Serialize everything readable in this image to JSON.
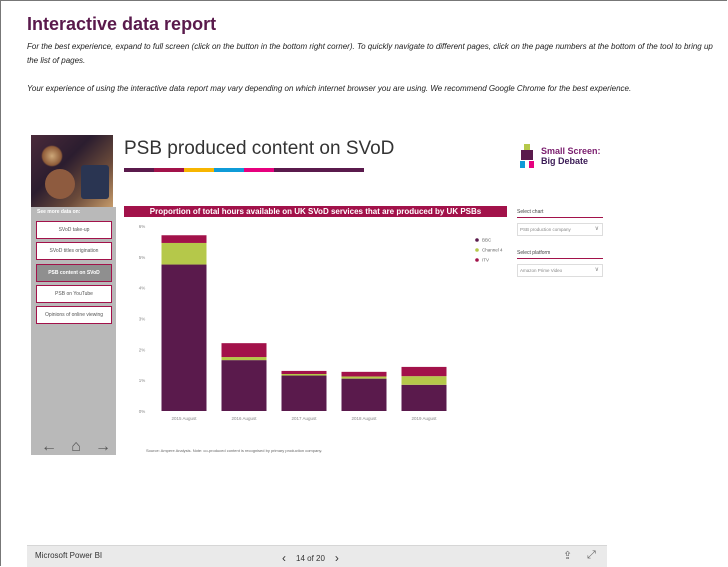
{
  "page": {
    "title": "Interactive data report",
    "intro1": "For the best experience, expand to full screen (click on the button in the bottom right corner). To quickly navigate to different pages, click on the page numbers at the bottom of the tool to bring up the list of pages.",
    "intro2": "Your experience of using the interactive data report may vary depending on which internet browser you are using. We recommend Google Chrome for the best experience."
  },
  "report": {
    "title": "PSB produced content on SVoD",
    "brand_line1": "Small Screen:",
    "brand_line2": "Big Debate",
    "color_bar": [
      "#5a1a4c",
      "#a2124a",
      "#f7b500",
      "#0f9bd7",
      "#e6007e",
      "#5a1a4c",
      "#5a1a4c",
      "#5a1a4c"
    ],
    "nav": {
      "header": "See more data on:",
      "items": [
        {
          "label": "SVoD take-up",
          "active": false
        },
        {
          "label": "SVoD titles origination",
          "active": false
        },
        {
          "label": "PSB content on SVoD",
          "active": true
        },
        {
          "label": "PSB on YouTube",
          "active": false
        },
        {
          "label": "Opinions of online viewing",
          "active": false
        }
      ]
    },
    "controls": {
      "chart_label": "Select chart",
      "chart_value": "PSB production company",
      "platform_label": "Select platform",
      "platform_value": "Amazon Prime Video"
    },
    "source": "Source: Ampere Analysis. Note: co-produced content is recognised by primary production company."
  },
  "chart_data": {
    "type": "bar",
    "stacked": true,
    "title": "Proportion of total hours available on UK SVoD services that are produced by UK PSBs",
    "categories": [
      "2015 August",
      "2016 August",
      "2017 August",
      "2018 August",
      "2019 August"
    ],
    "series": [
      {
        "name": "BBC",
        "color": "#5a1a4c",
        "values": [
          4.75,
          1.65,
          1.15,
          1.05,
          0.85
        ]
      },
      {
        "name": "Channel 4",
        "color": "#b5c84a",
        "values": [
          0.7,
          0.1,
          0.05,
          0.07,
          0.28
        ]
      },
      {
        "name": "ITV",
        "color": "#a2124a",
        "values": [
          0.25,
          0.45,
          0.1,
          0.15,
          0.3
        ]
      }
    ],
    "ylim": [
      0,
      6
    ],
    "yticks": [
      "0%",
      "1%",
      "2%",
      "3%",
      "4%",
      "5%",
      "6%"
    ],
    "legend_position": "top-right"
  },
  "footer": {
    "brand": "Microsoft Power BI",
    "pager": "14 of 20",
    "prev": "‹",
    "next": "›",
    "share_icon": "⇪",
    "expand_icon": "⤢"
  }
}
